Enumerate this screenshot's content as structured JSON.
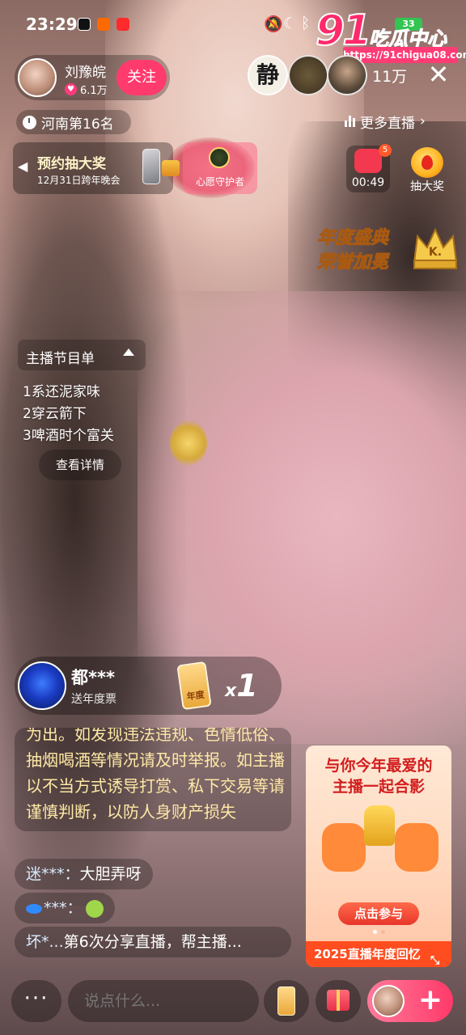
{
  "status_bar": {
    "time": "23:29",
    "battery": "33"
  },
  "watermark": {
    "number": "91",
    "name": "吃瓜中心",
    "url": "https://91chigua08.com"
  },
  "host": {
    "name": "刘豫皖",
    "likes": "6.1万",
    "follow_label": "关注"
  },
  "viewers": {
    "count": "11万",
    "first_viewer_text": "静"
  },
  "rank": {
    "label": "河南第16名"
  },
  "more_live": {
    "label": "更多直播"
  },
  "event": {
    "title": "预约抽大奖",
    "subtitle": "12月31日跨年晚会"
  },
  "guardian": {
    "label": "心愿守护者"
  },
  "red_packet": {
    "badge": "5",
    "timer": "00:49"
  },
  "lottery": {
    "label": "抽大奖"
  },
  "honor": {
    "line1": "年度盛典",
    "line2": "荣誉加冕"
  },
  "program": {
    "title": "主播节目单",
    "items": [
      "1系还泥家味",
      "2穿云箭下",
      "3啤酒时个富关"
    ],
    "detail_label": "查看详情"
  },
  "gift_notice": {
    "user": "都***",
    "desc": "送年度票",
    "ticket_label": "年度",
    "count_prefix": "x",
    "count": "1"
  },
  "chat": {
    "notice": "为出。如发现违法违规、色情低俗、抽烟喝酒等情况请及时举报。如主播以不当方式诱导打赏、私下交易等请谨慎判断，以防人身财产损失",
    "messages": [
      {
        "user": "迷***：",
        "text": "大胆弄呀"
      },
      {
        "user": "***：",
        "text": ""
      },
      {
        "user": "坏*...",
        "text": "第6次分享直播，帮主播..."
      }
    ]
  },
  "promo": {
    "line1": "与你今年最爱的",
    "line2": "主播一起合影",
    "cta": "点击参与",
    "footer": "2025直播年度回忆"
  },
  "bottom_bar": {
    "more_label": "···",
    "input_placeholder": "说点什么...",
    "plus_label": "+"
  },
  "colors": {
    "accent": "#ff3b6d",
    "notice_text": "#ffe9a6",
    "promo_title": "#d21e1e",
    "promo_footer": "#ff4d20"
  }
}
